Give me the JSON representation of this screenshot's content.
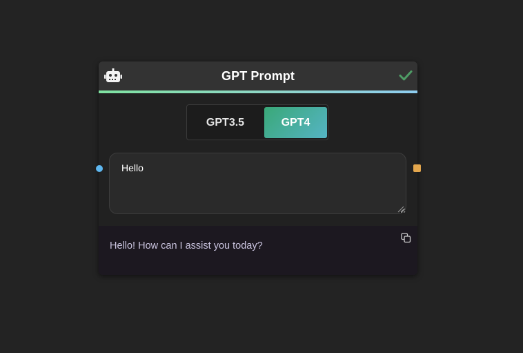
{
  "node": {
    "title": "GPT Prompt",
    "header_icon": "robot-icon",
    "status_icon": "check-icon",
    "accent_gradient": [
      "#7fe3a1",
      "#8ecdf0"
    ]
  },
  "model_toggle": {
    "options": [
      {
        "label": "GPT3.5",
        "selected": false
      },
      {
        "label": "GPT4",
        "selected": true
      }
    ],
    "active_gradient": [
      "#3aa878",
      "#55b4c4"
    ]
  },
  "prompt": {
    "value": "Hello"
  },
  "response": {
    "text": "Hello! How can I assist you today?",
    "copy_icon": "copy-icon"
  },
  "ports": {
    "input_color": "#5eb7f0",
    "output_color": "#e3a64d"
  }
}
